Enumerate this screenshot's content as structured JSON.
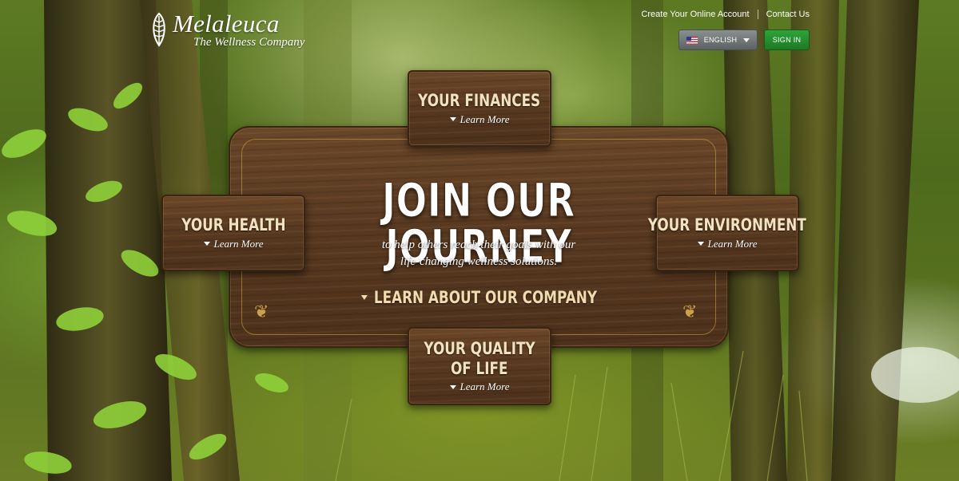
{
  "header": {
    "logo_name": "Melaleuca",
    "logo_tagline": "The Wellness Company",
    "links": [
      {
        "label": "Create Your Online Account"
      },
      {
        "label": "Contact Us"
      }
    ],
    "language": {
      "label": "ENGLISH",
      "icon": "us-flag-icon"
    },
    "sign_in_label": "SIGN IN",
    "colors": {
      "sign_in": "#1f8a2a",
      "language_btn": "#6e7475"
    }
  },
  "hero": {
    "headline": "JOIN OUR JOURNEY",
    "subline_1": "to help others reach their goals with our",
    "subline_2": "life-changing wellness solutions.",
    "company_link": "LEARN ABOUT OUR COMPANY"
  },
  "signs": {
    "finances": {
      "title": "YOUR FINANCES",
      "link": "Learn More"
    },
    "health": {
      "title": "YOUR HEALTH",
      "link": "Learn More"
    },
    "environment": {
      "title": "YOUR ENVIRONMENT",
      "link": "Learn More"
    },
    "quality": {
      "title_1": "YOUR QUALITY",
      "title_2": "OF LIFE",
      "link": "Learn More"
    }
  }
}
